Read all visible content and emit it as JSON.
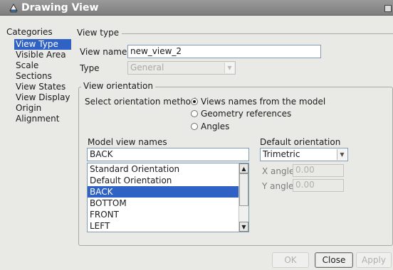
{
  "window": {
    "title": "Drawing View"
  },
  "categories": {
    "label": "Categories",
    "items": [
      "View Type",
      "Visible Area",
      "Scale",
      "Sections",
      "View States",
      "View Display",
      "Origin",
      "Alignment"
    ],
    "selected": "View Type"
  },
  "view_type": {
    "section_label": "View type",
    "view_name_label": "View name",
    "view_name_value": "new_view_2",
    "type_label": "Type",
    "type_value": "General"
  },
  "view_orientation": {
    "group_label": "View orientation",
    "method_label": "Select orientation method",
    "options": [
      "Views names from the model",
      "Geometry references",
      "Angles"
    ],
    "selected_option": "Views names from the model",
    "model_view_names_label": "Model view names",
    "model_view_name_value": "BACK",
    "model_views": [
      "Standard Orientation",
      "Default Orientation",
      "BACK",
      "BOTTOM",
      "FRONT",
      "LEFT"
    ],
    "selected_model_view": "BACK",
    "default_orientation_label": "Default orientation",
    "default_orientation_value": "Trimetric",
    "x_angle_label": "X angle",
    "x_angle_value": "0.00",
    "y_angle_label": "Y angle",
    "y_angle_value": "0.00"
  },
  "buttons": {
    "ok": "OK",
    "close": "Close",
    "apply": "Apply"
  }
}
